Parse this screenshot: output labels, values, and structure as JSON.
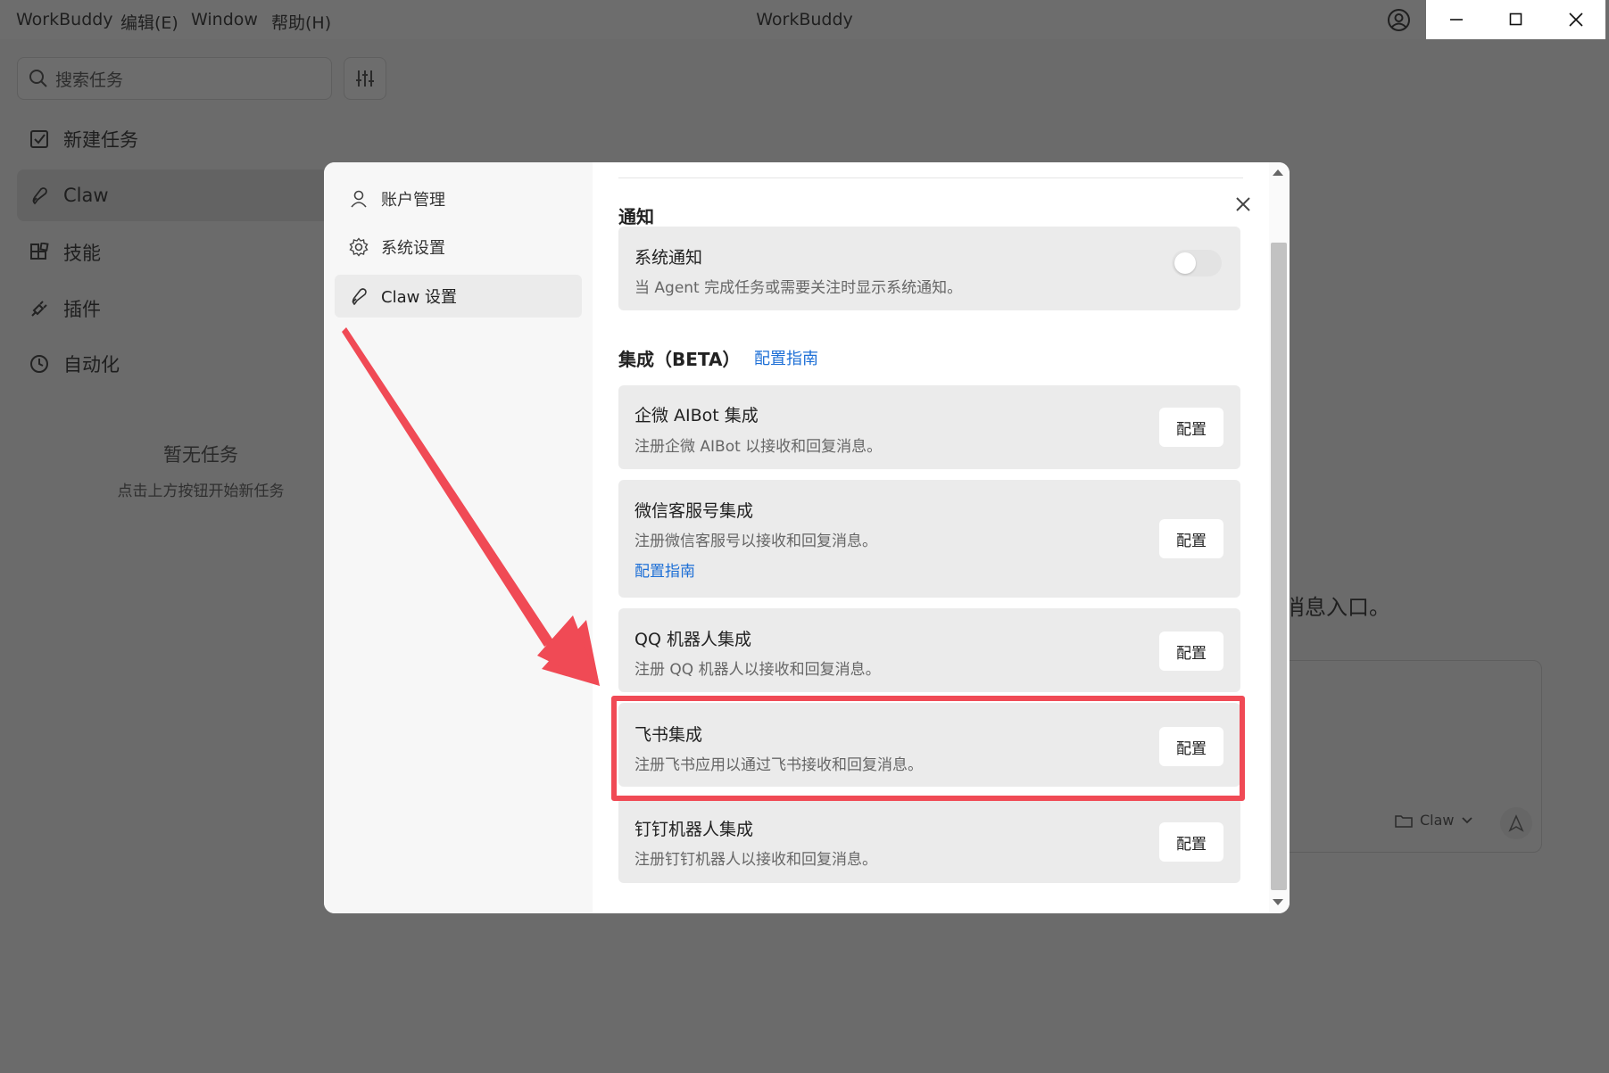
{
  "window": {
    "app_name": "WorkBuddy",
    "title": "WorkBuddy",
    "menus": [
      "编辑(E)",
      "Window",
      "帮助(H)"
    ]
  },
  "sidebar": {
    "search_placeholder": "搜索任务",
    "items": [
      {
        "label": "新建任务",
        "icon": "new-task-icon"
      },
      {
        "label": "Claw",
        "icon": "claw-icon"
      },
      {
        "label": "技能",
        "icon": "skills-icon"
      },
      {
        "label": "插件",
        "icon": "plugin-icon"
      },
      {
        "label": "自动化",
        "icon": "clock-icon"
      }
    ],
    "empty_title": "暂无任务",
    "empty_subtitle": "点击上方按钮开始新任务"
  },
  "background": {
    "partial_text": "消息入口。",
    "folder_label": "Claw"
  },
  "settings_modal": {
    "nav": [
      {
        "label": "账户管理",
        "icon": "user-icon"
      },
      {
        "label": "系统设置",
        "icon": "gear-icon"
      },
      {
        "label": "Claw 设置",
        "icon": "claw-icon",
        "active": true
      }
    ],
    "notify_section_title": "通知",
    "system_notify": {
      "title": "系统通知",
      "desc": "当 Agent 完成任务或需要关注时显示系统通知。",
      "enabled": false
    },
    "integration_section_title": "集成（BETA）",
    "integration_guide_link": "配置指南",
    "integrations": [
      {
        "title": "企微 AIBot 集成",
        "desc": "注册企微 AIBot 以接收和回复消息。",
        "button": "配置"
      },
      {
        "title": "微信客服号集成",
        "desc": "注册微信客服号以接收和回复消息。",
        "link": "配置指南",
        "button": "配置"
      },
      {
        "title": "QQ 机器人集成",
        "desc": "注册 QQ 机器人以接收和回复消息。",
        "button": "配置"
      },
      {
        "title": "飞书集成",
        "desc": "注册飞书应用以通过飞书接收和回复消息。",
        "button": "配置"
      },
      {
        "title": "钉钉机器人集成",
        "desc": "注册钉钉机器人以接收和回复消息。",
        "button": "配置"
      }
    ]
  },
  "annotation": {
    "highlight_color": "#f04a55"
  }
}
